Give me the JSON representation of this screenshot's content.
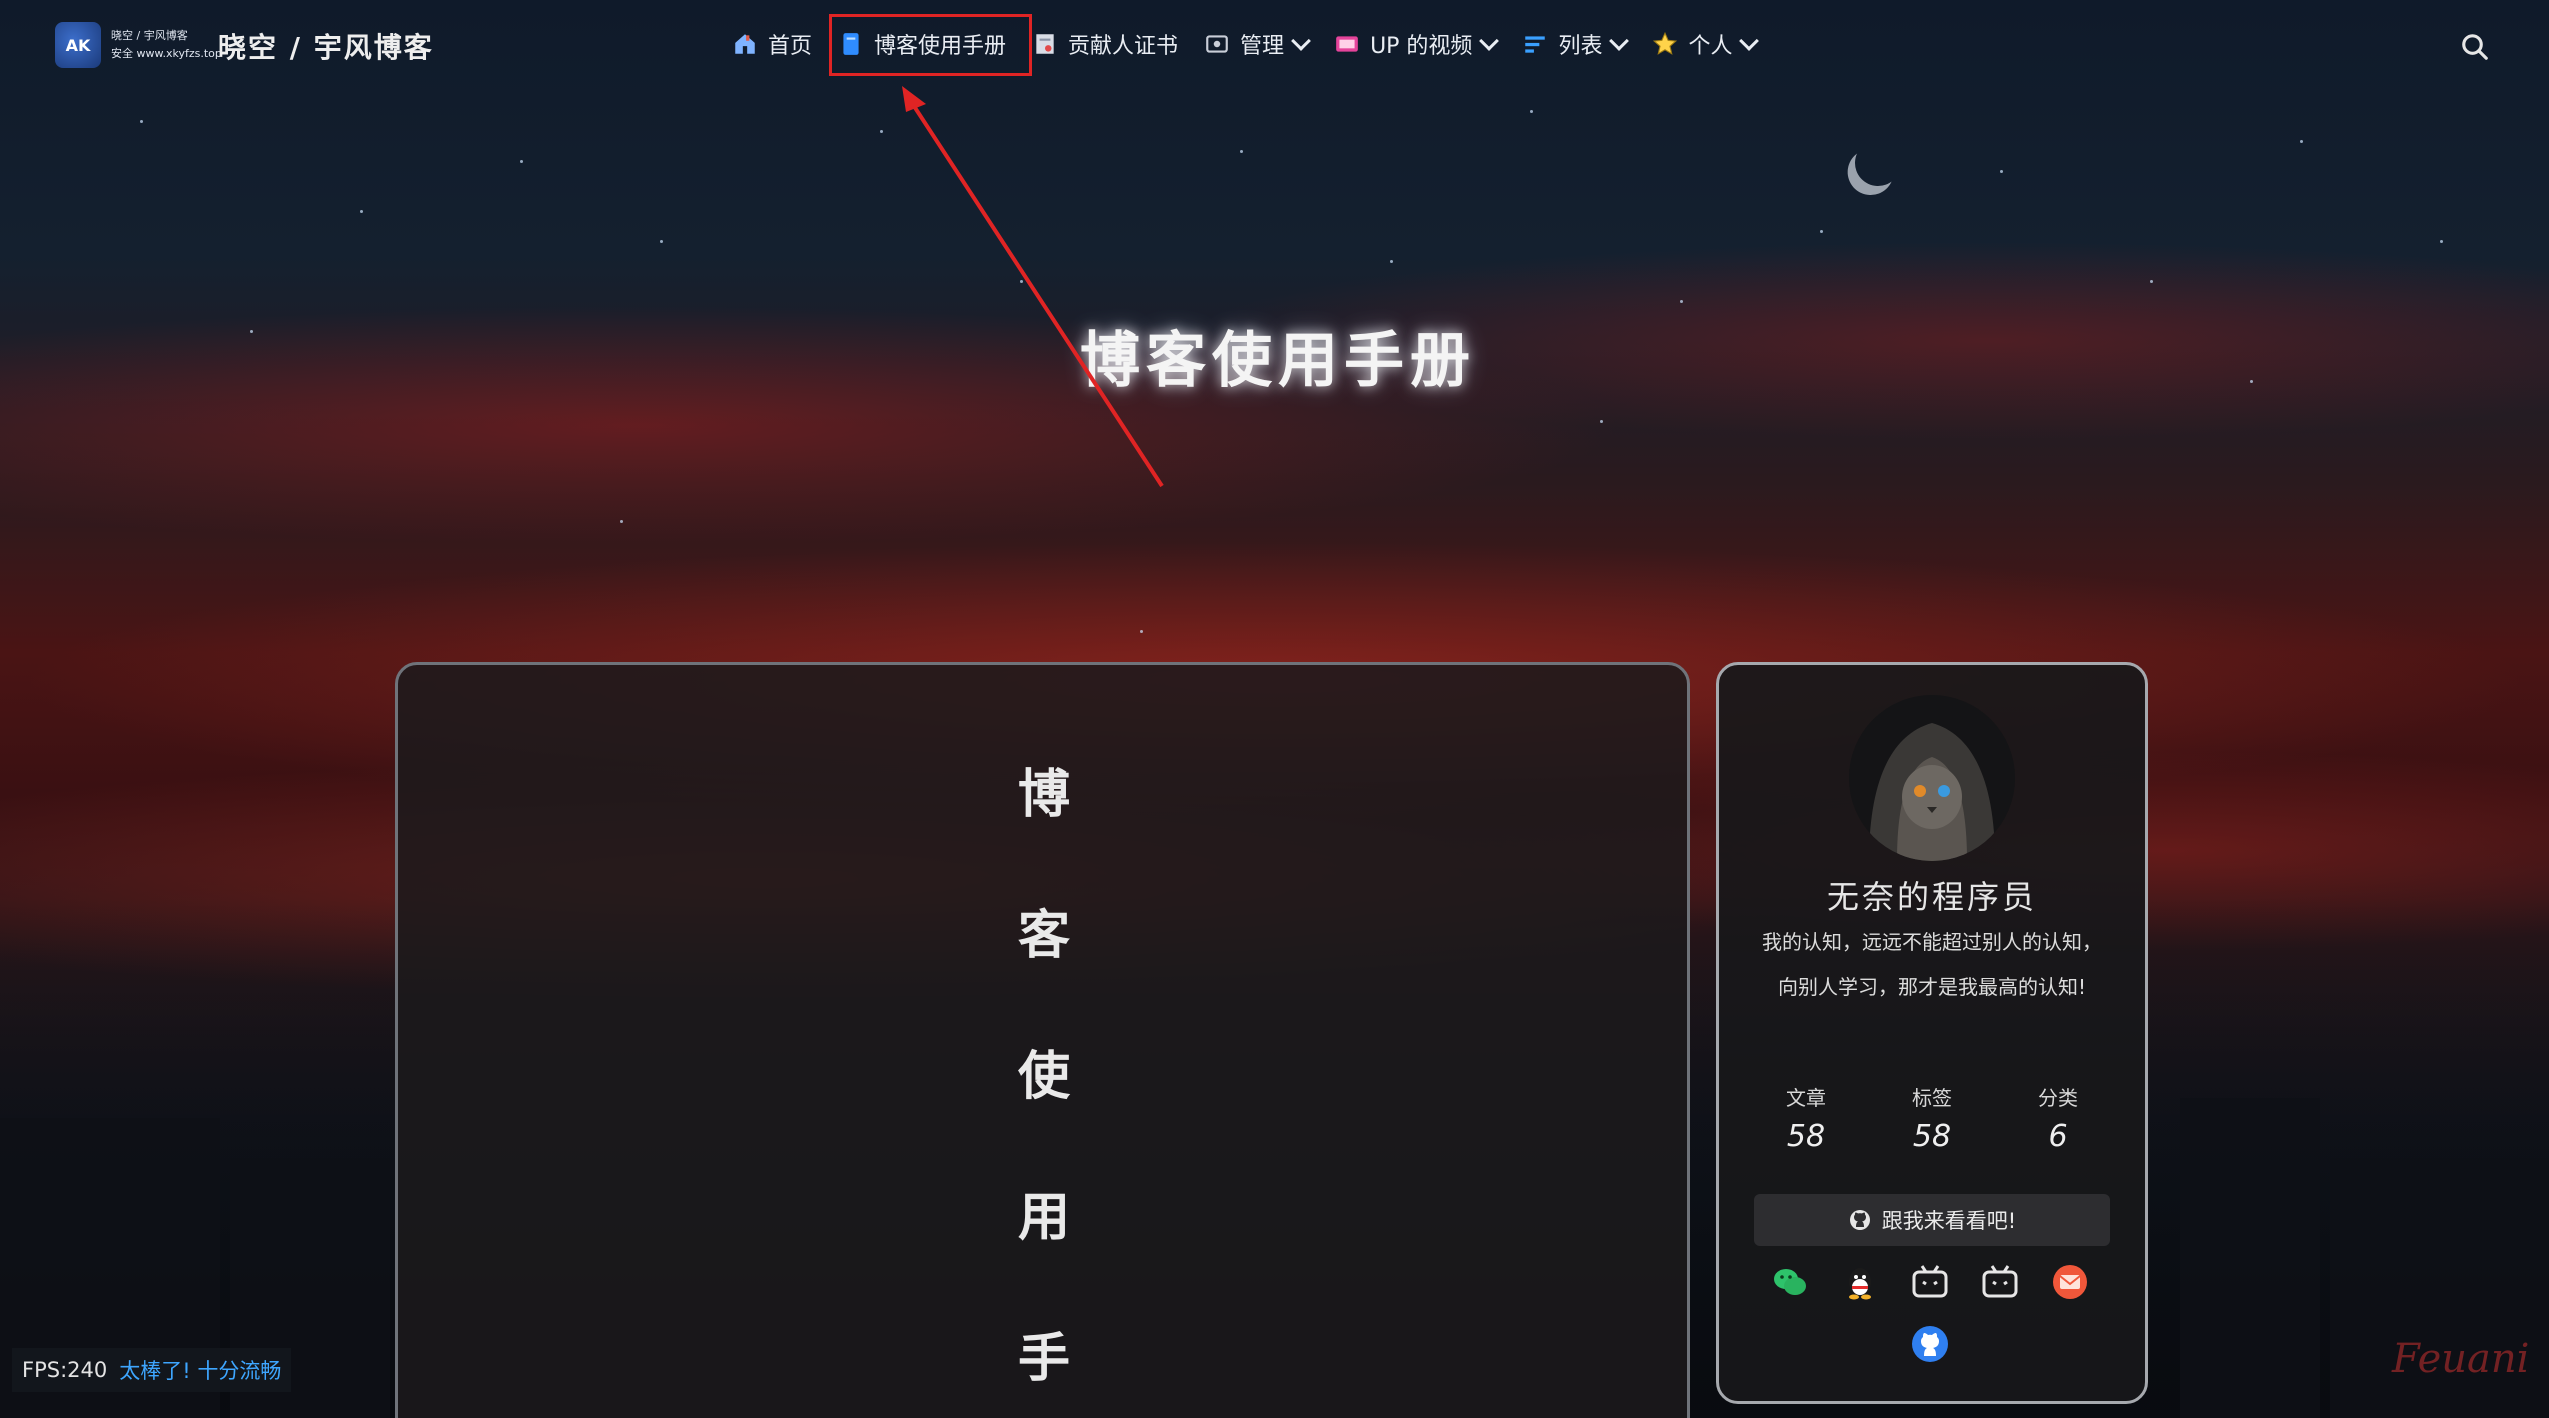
{
  "logo": {
    "badge": "AK",
    "line1": "晓空 / 宇风博客",
    "line2": "安全 www.xkyfzs.top"
  },
  "site": {
    "title": "晓空 / 宇风博客"
  },
  "menu": [
    {
      "label": "首页",
      "icon": "home-icon",
      "dropdown": false
    },
    {
      "label": "博客使用手册",
      "icon": "book-icon",
      "dropdown": false
    },
    {
      "label": "贡献人证书",
      "icon": "certificate-icon",
      "dropdown": false
    },
    {
      "label": "管理",
      "icon": "manage-icon",
      "dropdown": true
    },
    {
      "label": "UP 的视频",
      "icon": "video-icon",
      "dropdown": true
    },
    {
      "label": "列表",
      "icon": "list-icon",
      "dropdown": true
    },
    {
      "label": "个人",
      "icon": "star-icon",
      "dropdown": true
    }
  ],
  "highlighted_menu_item": "博客使用手册",
  "hero": {
    "title": "博客使用手册"
  },
  "article": {
    "vertical_title_chars": [
      "博",
      "客",
      "使",
      "用",
      "手"
    ]
  },
  "author": {
    "name": "无奈的程序员",
    "bio": "我的认知，远远不能超过别人的认知，向别人学习，那才是我最高的认知!",
    "stats": [
      {
        "label": "文章",
        "value": "58"
      },
      {
        "label": "标签",
        "value": "58"
      },
      {
        "label": "分类",
        "value": "6"
      }
    ],
    "follow_label": "跟我来看看吧!",
    "socials": [
      "wechat-icon",
      "qq-icon",
      "bilibili-icon",
      "bilibili-icon",
      "email-icon",
      "github-icon"
    ]
  },
  "fps": {
    "value": "FPS:240",
    "message": "太棒了! 十分流畅"
  },
  "signature": "Feuani",
  "colors": {
    "highlight": "#e02424",
    "fps_message": "#3ea6ff"
  }
}
